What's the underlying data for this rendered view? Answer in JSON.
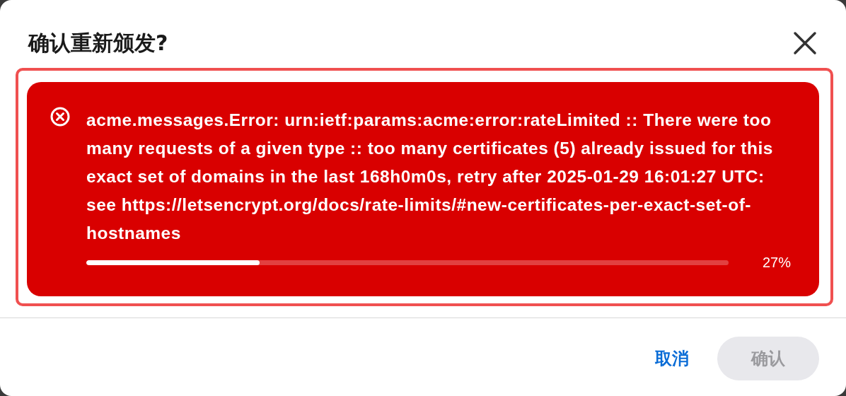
{
  "dialog": {
    "title": "确认重新颁发?"
  },
  "alert": {
    "message": "acme.messages.Error: urn:ietf:params:acme:error:rateLimited :: There were too many requests of a given type :: too many certificates (5) already issued for this exact set of domains in the last 168h0m0s, retry after 2025-01-29 16:01:27 UTC: see https://letsencrypt.org/docs/rate-limits/#new-certificates-per-exact-set-of-hostnames",
    "focused": true,
    "progress": {
      "level": 0.27,
      "reading": "27%"
    }
  },
  "buttons": [
    {
      "label": "取消",
      "kind": "link",
      "disabled": false
    },
    {
      "label": "确认",
      "kind": "primary",
      "disabled": true
    }
  ]
}
